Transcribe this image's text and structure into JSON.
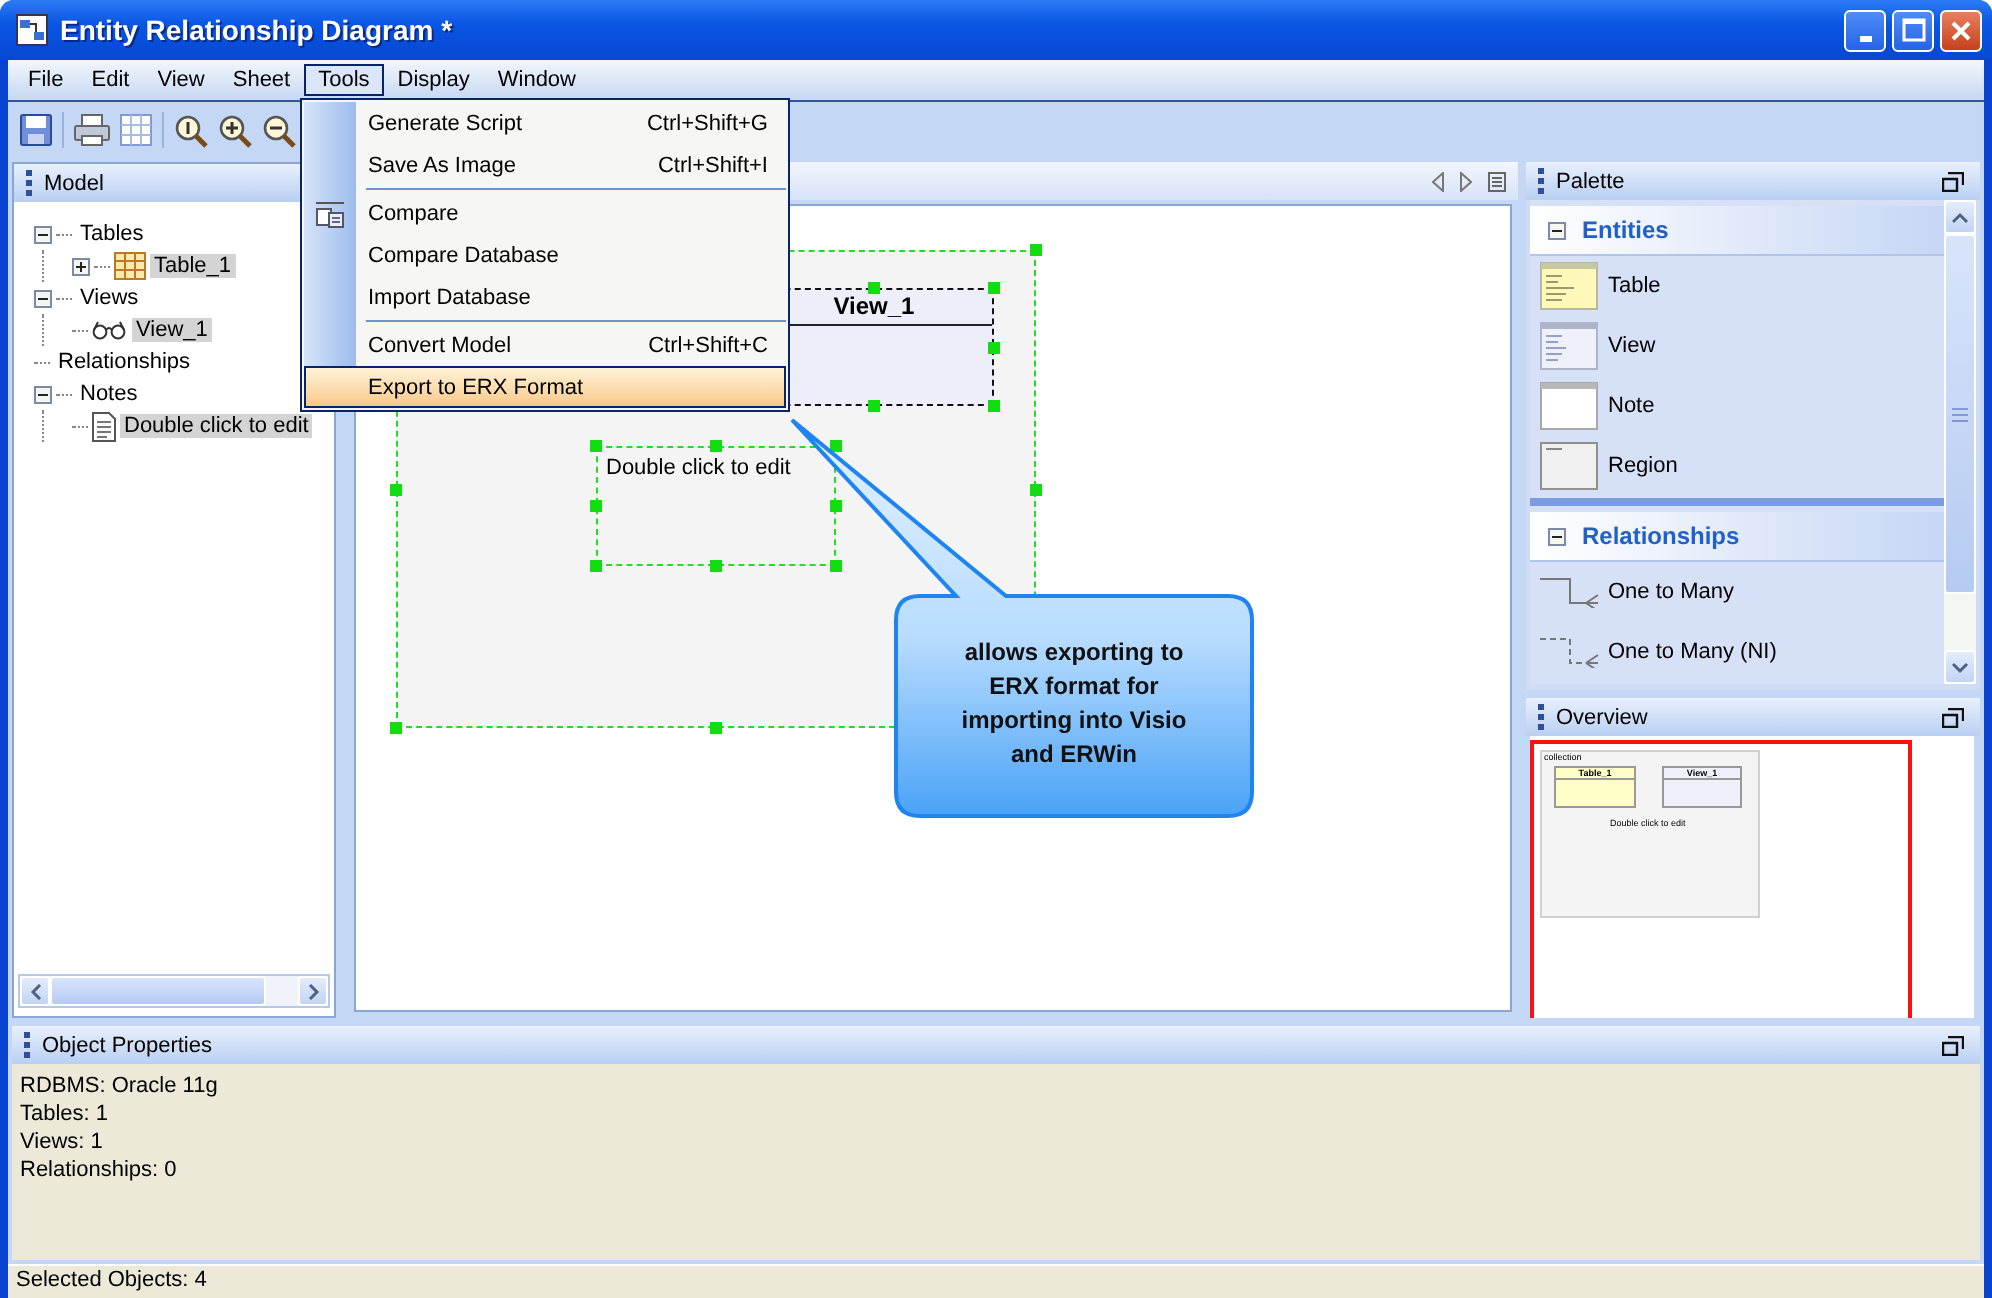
{
  "window": {
    "title": "Entity Relationship Diagram *"
  },
  "menu_bar": [
    {
      "label": "File",
      "selected": false
    },
    {
      "label": "Edit",
      "selected": false
    },
    {
      "label": "View",
      "selected": false
    },
    {
      "label": "Sheet",
      "selected": false
    },
    {
      "label": "Tools",
      "selected": true
    },
    {
      "label": "Display",
      "selected": false
    },
    {
      "label": "Window",
      "selected": false
    }
  ],
  "tools_menu": {
    "items": [
      {
        "kind": "item",
        "label": "Generate Script",
        "shortcut": "Ctrl+Shift+G",
        "has_icon": false,
        "selected": false
      },
      {
        "kind": "item",
        "label": "Save As Image",
        "shortcut": "Ctrl+Shift+I",
        "has_icon": false,
        "selected": false
      },
      {
        "kind": "separator"
      },
      {
        "kind": "item",
        "label": "Compare",
        "has_icon": true,
        "selected": false
      },
      {
        "kind": "item",
        "label": "Compare Database",
        "has_icon": false,
        "selected": false
      },
      {
        "kind": "item",
        "label": "Import Database",
        "has_icon": false,
        "selected": false
      },
      {
        "kind": "separator"
      },
      {
        "kind": "item",
        "label": "Convert Model",
        "shortcut": "Ctrl+Shift+C",
        "has_icon": false,
        "selected": false
      },
      {
        "kind": "item",
        "label": "Export to ERX Format",
        "has_icon": false,
        "selected": true
      }
    ]
  },
  "model_panel": {
    "title": "Model",
    "tree": [
      {
        "label": "Tables",
        "expanded": true,
        "selected": false,
        "children": [
          {
            "kind": "table",
            "label": "Table_1",
            "expanded": false,
            "selected": true
          }
        ]
      },
      {
        "label": "Views",
        "expanded": true,
        "selected": false,
        "children": [
          {
            "kind": "view",
            "label": "View_1",
            "selected": true
          }
        ]
      },
      {
        "label": "Relationships",
        "selected": false
      },
      {
        "label": "Notes",
        "expanded": true,
        "selected": false,
        "children": [
          {
            "kind": "note",
            "label": "Double click to edit",
            "selected": true
          }
        ]
      }
    ]
  },
  "canvas": {
    "objects": [
      {
        "kind": "region",
        "selected": true
      },
      {
        "kind": "view",
        "name": "View_1",
        "selected": true
      },
      {
        "kind": "note",
        "text": "Double click to edit",
        "selected": true
      }
    ]
  },
  "callout": {
    "text": "allows exporting to ERX format for importing into Visio and ERWin"
  },
  "palette": {
    "title": "Palette",
    "groups": [
      {
        "title": "Entities",
        "expanded": true,
        "items": [
          {
            "kind": "table",
            "label": "Table"
          },
          {
            "kind": "view",
            "label": "View"
          },
          {
            "kind": "note",
            "label": "Note"
          },
          {
            "kind": "region",
            "label": "Region"
          }
        ]
      },
      {
        "title": "Relationships",
        "expanded": true,
        "items": [
          {
            "kind": "solid_link",
            "label": "One to Many"
          },
          {
            "kind": "dashed_link",
            "label": "One to Many (NI)"
          }
        ]
      }
    ]
  },
  "overview": {
    "title": "Overview",
    "region_label": "collection",
    "table_name": "Table_1",
    "view_name": "View_1",
    "note_text": "Double click to edit"
  },
  "properties": {
    "title": "Object Properties",
    "lines": [
      "RDBMS: Oracle 11g",
      "Tables: 1",
      "Views: 1",
      "Relationships: 0"
    ]
  },
  "status_bar": {
    "text": "Selected Objects: 4"
  }
}
